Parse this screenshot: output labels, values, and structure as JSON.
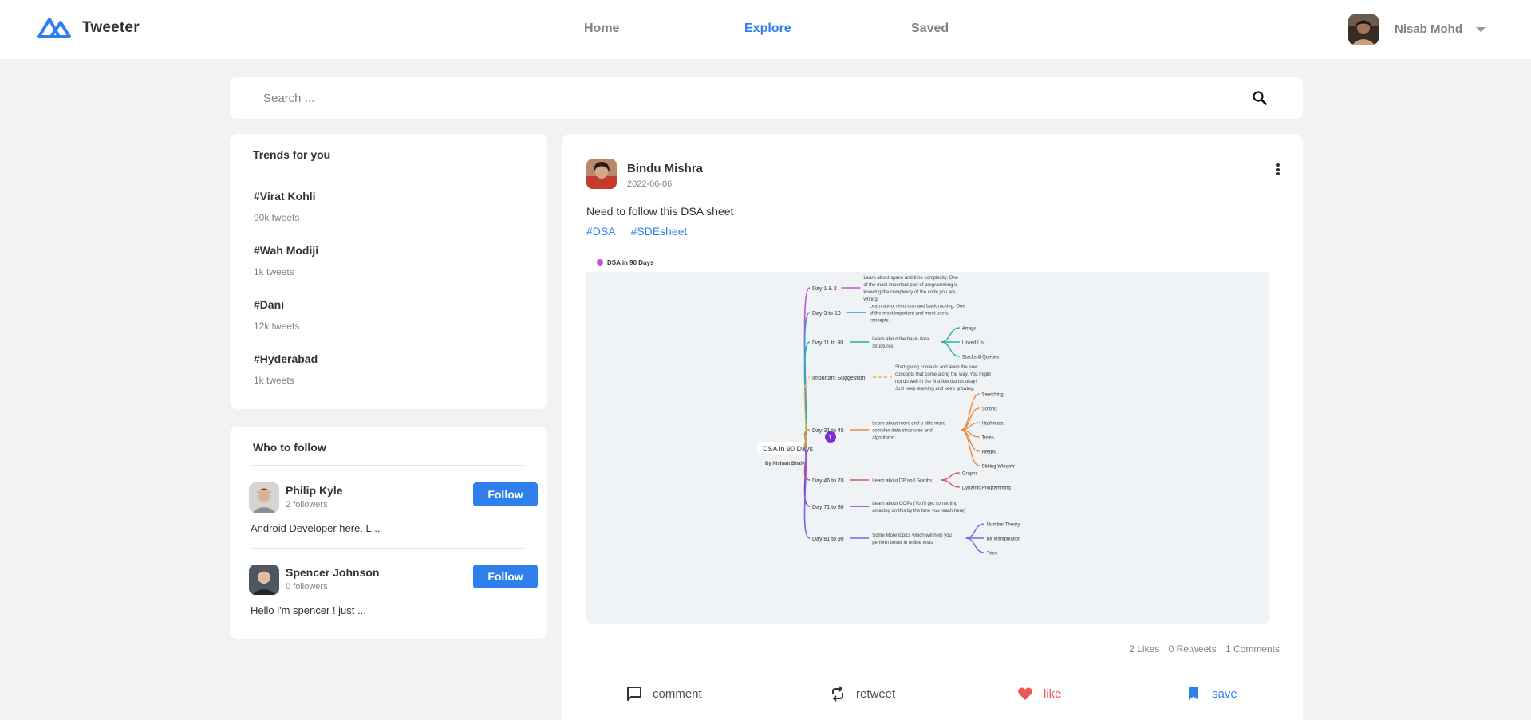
{
  "header": {
    "brand": "Tweeter",
    "nav": [
      {
        "label": "Home",
        "active": false
      },
      {
        "label": "Explore",
        "active": true
      },
      {
        "label": "Saved",
        "active": false
      }
    ],
    "user_name": "Nisab Mohd"
  },
  "search": {
    "placeholder": "Search ..."
  },
  "trends": {
    "title": "Trends for you",
    "items": [
      {
        "tag": "#Virat Kohli",
        "count": "90k tweets"
      },
      {
        "tag": "#Wah Modiji",
        "count": "1k tweets"
      },
      {
        "tag": "#Dani",
        "count": "12k tweets"
      },
      {
        "tag": "#Hyderabad",
        "count": "1k tweets"
      }
    ]
  },
  "who_to_follow": {
    "title": "Who to follow",
    "people": [
      {
        "name": "Philip Kyle",
        "followers": "2 followers",
        "bio": "Android Developer here. L...",
        "button": "Follow"
      },
      {
        "name": "Spencer Johnson",
        "followers": "0 followers",
        "bio": "Hello i'm spencer ! just ...",
        "button": "Follow"
      }
    ]
  },
  "post": {
    "author": "Bindu Mishra",
    "date": "2022-06-06",
    "text": "Need to follow this DSA sheet",
    "tags": [
      "#DSA",
      "#SDEsheet"
    ],
    "image": {
      "header": "DSA in 90 Days",
      "root": "DSA in 90 Days",
      "byline": "By Nishant Bhaiya",
      "badge": "1",
      "branches": [
        {
          "label": "Day 1 & 2",
          "note": "Learn about space and time complexity. One of the most important part of programming is knowing the complexity of the code you are writing.",
          "leaves": [],
          "color": "#c94fd6"
        },
        {
          "label": "Day 3 to 10",
          "note": "Learn about recursion and backtracking. One of the most important and most useful concepts.",
          "leaves": [],
          "color": "#3f8fd8"
        },
        {
          "label": "Day 11 to 30",
          "note": "Learn about the basic data structures",
          "leaves": [
            "Arrays",
            "Linked List",
            "Stacks & Queues"
          ],
          "color": "#21b2a6"
        },
        {
          "label": "Important Suggestion",
          "note": "Start giving contests and learn the new concepts that come along the way. You might not do well in the first few but it's okay! Just keep learning and keep growing.",
          "leaves": [],
          "color": "#f0b53c"
        },
        {
          "label": "Day 31 to 45",
          "note": "Learn about more and a little more complex data structures and algorithms",
          "leaves": [
            "Searching",
            "Sorting",
            "Hashmaps",
            "Trees",
            "Heaps",
            "Sliding Window"
          ],
          "color": "#f08a3c"
        },
        {
          "label": "Day 46 to 70",
          "note": "Learn about DP and Graphs.",
          "leaves": [
            "Graphs",
            "Dynamic Programming"
          ],
          "color": "#e0525f"
        },
        {
          "label": "Day 71 to 80",
          "note": "Learn about OOPs (You'll get something amazing on this by the time you reach here)",
          "leaves": [],
          "color": "#8a35c9"
        },
        {
          "label": "Day 81 to 90",
          "note": "Some More topics which will help you perform better in online tests",
          "leaves": [
            "Number Theory",
            "Bit Manipulation",
            "Tries"
          ],
          "color": "#7d63e0"
        }
      ]
    },
    "stats": {
      "likes": "2 Likes",
      "retweets": "0 Retweets",
      "comments": "1 Comments"
    },
    "actions": {
      "comment": "comment",
      "retweet": "retweet",
      "like": "like",
      "save": "save"
    }
  },
  "colors": {
    "accent": "#2F80ED",
    "like": "#EB5757",
    "background": "#F2F2F2"
  },
  "icons": [
    "logo-icon",
    "search-icon",
    "chevron-down-icon",
    "more-vertical-icon",
    "comment-icon",
    "retweet-icon",
    "heart-icon",
    "bookmark-icon"
  ]
}
